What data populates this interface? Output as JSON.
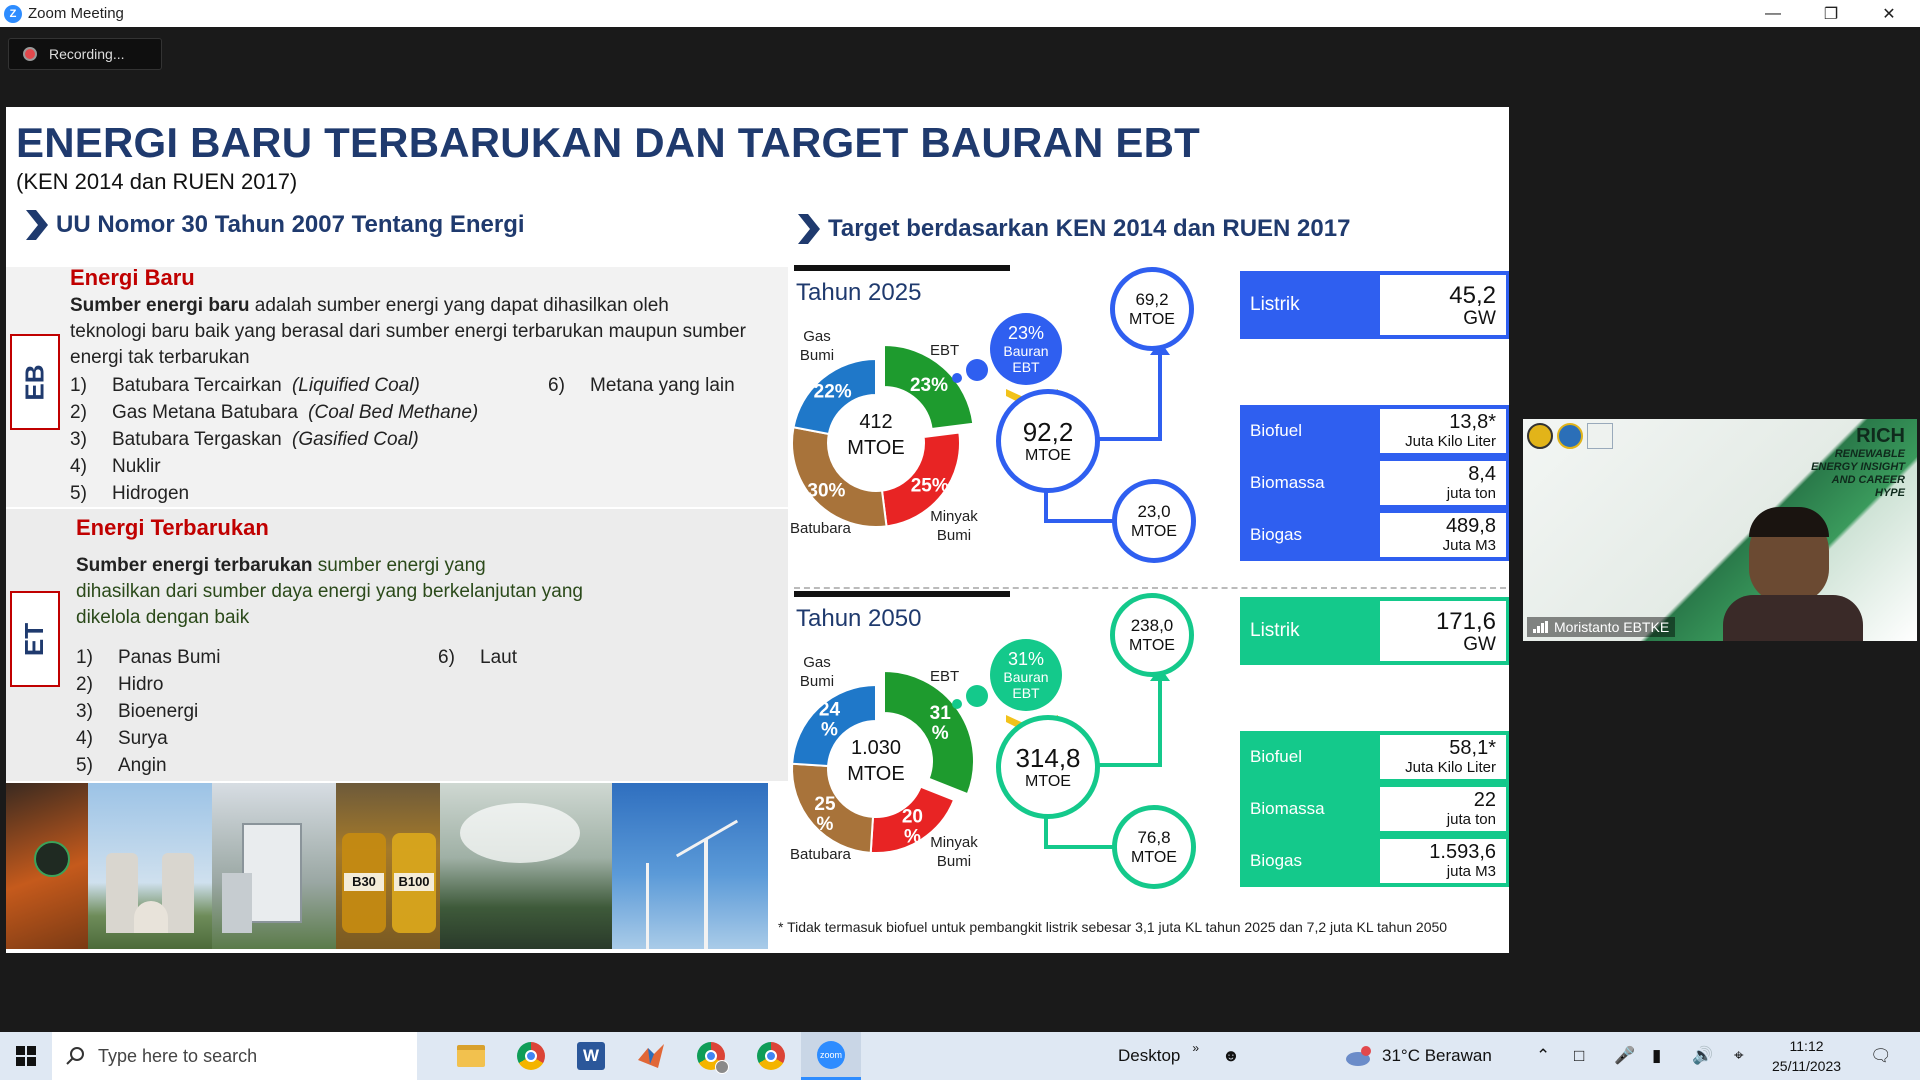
{
  "window": {
    "app_icon": "zoom-logo",
    "title": "Zoom Meeting"
  },
  "recording": {
    "label": "Recording..."
  },
  "slide": {
    "title": "ENERGI BARU TERBARUKAN DAN TARGET BAURAN EBT",
    "subtitle": "(KEN 2014 dan RUEN 2017)",
    "left_heading": "UU Nomor 30 Tahun 2007 Tentang Energi",
    "right_heading": "Target berdasarkan KEN 2014 dan RUEN 2017",
    "eb": {
      "tag": "EB",
      "heading": "Energi Baru",
      "def_bold": "Sumber energi baru",
      "def_rest": " adalah sumber energi yang dapat dihasilkan oleh teknologi baru baik yang berasal dari sumber energi terbarukan maupun sumber energi tak terbarukan",
      "items": [
        {
          "num": "1)",
          "text": "Batubara Tercairkan ",
          "italic": "(Liquified Coal)"
        },
        {
          "num": "2)",
          "text": "Gas Metana Batubara ",
          "italic": "(Coal Bed Methane)"
        },
        {
          "num": "3)",
          "text": "Batubara Tergaskan ",
          "italic": "(Gasified Coal)"
        },
        {
          "num": "4)",
          "text": "Nuklir",
          "italic": ""
        },
        {
          "num": "5)",
          "text": "Hidrogen",
          "italic": ""
        }
      ],
      "item6": {
        "num": "6)",
        "text": "Metana yang lain"
      }
    },
    "et": {
      "tag": "ET",
      "heading": "Energi Terbarukan",
      "def_bold": "Sumber energi terbarukan",
      "def_line1": "  sumber energi yang",
      "def_line2": "dihasilkan dari sumber daya energi yang berkelanjutan yang",
      "def_line3": "dikelola dengan baik",
      "items": [
        {
          "num": "1)",
          "text": "Panas Bumi"
        },
        {
          "num": "2)",
          "text": "Hidro"
        },
        {
          "num": "3)",
          "text": "Bioenergi"
        },
        {
          "num": "4)",
          "text": "Surya"
        },
        {
          "num": "5)",
          "text": "Angin"
        }
      ],
      "item6": {
        "num": "6)",
        "text": "Laut"
      }
    },
    "photo_labels": {
      "b30": "B30",
      "b100": "B100"
    },
    "y2025": {
      "year": "Tahun 2025",
      "center_value": "412",
      "center_unit": "MTOE",
      "labels": {
        "gas": [
          "Gas",
          "Bumi"
        ],
        "ebt": "EBT",
        "batubara": "Batubara",
        "minyak": [
          "Minyak",
          "Bumi"
        ]
      },
      "bauran_pct": "23%",
      "bauran_l1": "Bauran",
      "bauran_l2": "EBT",
      "total_value": "92,2",
      "total_unit": "MTOE",
      "upper_value": "69,2",
      "upper_unit": "MTOE",
      "lower_value": "23,0",
      "lower_unit": "MTOE",
      "metrics": [
        {
          "label": "Listrik",
          "value": "45,2",
          "unit": "GW"
        },
        {
          "label": "Biofuel",
          "value": "13,8*",
          "unit": "Juta Kilo Liter"
        },
        {
          "label": "Biomassa",
          "value": "8,4",
          "unit": "juta ton"
        },
        {
          "label": "Biogas",
          "value": "489,8",
          "unit": "Juta M3"
        }
      ],
      "accent": "#2f5ff0"
    },
    "y2050": {
      "year": "Tahun 2050",
      "center_value": "1.030",
      "center_unit": "MTOE",
      "labels": {
        "gas": [
          "Gas",
          "Bumi"
        ],
        "ebt": "EBT",
        "batubara": "Batubara",
        "minyak": [
          "Minyak",
          "Bumi"
        ]
      },
      "bauran_pct": "31%",
      "bauran_l1": "Bauran",
      "bauran_l2": "EBT",
      "total_value": "314,8",
      "total_unit": "MTOE",
      "upper_value": "238,0",
      "upper_unit": "MTOE",
      "lower_value": "76,8",
      "lower_unit": "MTOE",
      "metrics": [
        {
          "label": "Listrik",
          "value": "171,6",
          "unit": "GW"
        },
        {
          "label": "Biofuel",
          "value": "58,1*",
          "unit": "Juta Kilo Liter"
        },
        {
          "label": "Biomassa",
          "value": "22",
          "unit": "juta ton"
        },
        {
          "label": "Biogas",
          "value": "1.593,6",
          "unit": "juta M3"
        }
      ],
      "accent": "#14c98b"
    },
    "chart_data": [
      {
        "type": "pie",
        "title": "Tahun 2025",
        "categories": [
          "EBT",
          "Minyak Bumi",
          "Batubara",
          "Gas Bumi"
        ],
        "values": [
          23,
          25,
          30,
          22
        ],
        "value_labels": [
          "23%",
          "25%",
          "30%",
          "22%"
        ],
        "colors": [
          "#1e9b2e",
          "#e82424",
          "#a8733a",
          "#1f78c9"
        ]
      },
      {
        "type": "pie",
        "title": "Tahun 2050",
        "categories": [
          "EBT",
          "Minyak Bumi",
          "Batubara",
          "Gas Bumi"
        ],
        "values": [
          31,
          20,
          25,
          24
        ],
        "value_labels": [
          [
            "31",
            "%"
          ],
          [
            "20",
            "%"
          ],
          [
            "25",
            "%"
          ],
          [
            "24",
            "%"
          ]
        ],
        "colors": [
          "#1e9b2e",
          "#e82424",
          "#a8733a",
          "#1f78c9"
        ]
      }
    ],
    "footnote": "* Tidak termasuk biofuel untuk pembangkit listrik sebesar 3,1 juta KL tahun 2025 dan 7,2 juta KL tahun 2050"
  },
  "video": {
    "brand": "RICH",
    "tagline": [
      "RENEWABLE",
      "ENERGY INSIGHT",
      "AND CAREER",
      "HYPE"
    ],
    "participant": "Moristanto EBTKE"
  },
  "taskbar": {
    "search_placeholder": "Type here to search",
    "apps": [
      "file-explorer-icon",
      "chrome-icon",
      "word-icon",
      "matlab-icon",
      "chrome-profile-icon",
      "chrome-alt-icon",
      "zoom-icon"
    ],
    "desktop_label": "Desktop",
    "weather": "31°C  Berawan",
    "time": "11:12",
    "date": "25/11/2023"
  }
}
